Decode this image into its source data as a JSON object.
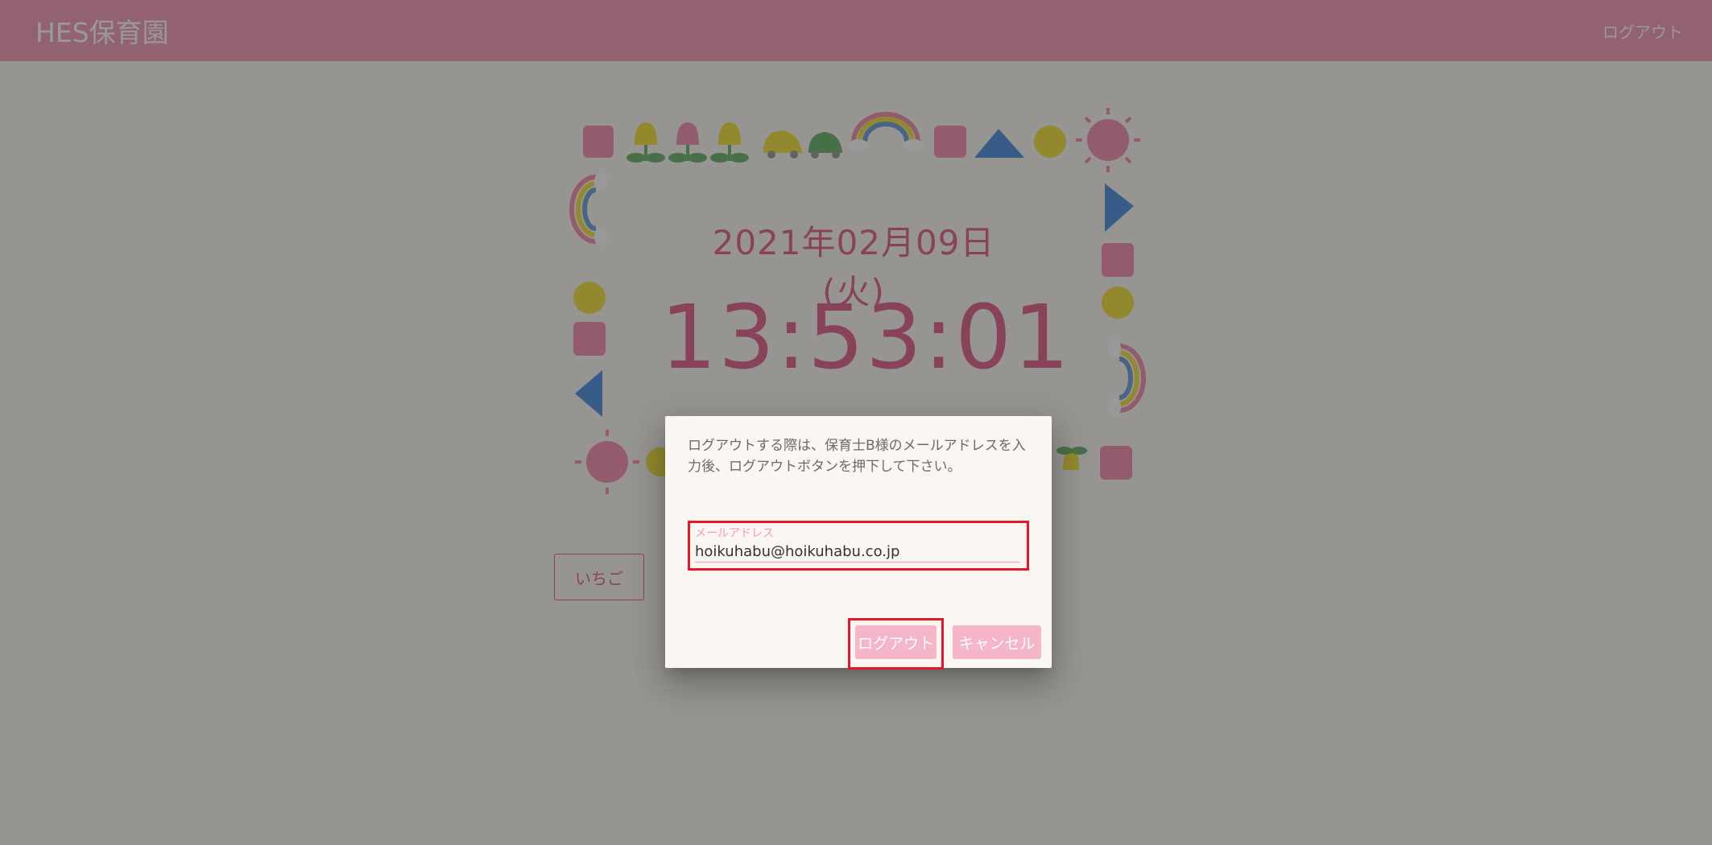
{
  "header": {
    "brand": "HES保育園",
    "logout_label": "ログアウト"
  },
  "main": {
    "date": "2021年02月09日(火)",
    "time": "13:53:01",
    "class_button_label": "いちご"
  },
  "dialog": {
    "message": "ログアウトする際は、保育士B様のメールアドレスを入力後、ログアウトボタンを押下して下さい。",
    "email_label": "メールアドレス",
    "email_value": "hoikuhabu@hoikuhabu.co.jp",
    "logout_button": "ログアウト",
    "cancel_button": "キャンセル"
  },
  "colors": {
    "header": "#f39ab5",
    "accent": "#e0608c",
    "highlight": "#e21a2a",
    "button": "#f5b6c9"
  }
}
